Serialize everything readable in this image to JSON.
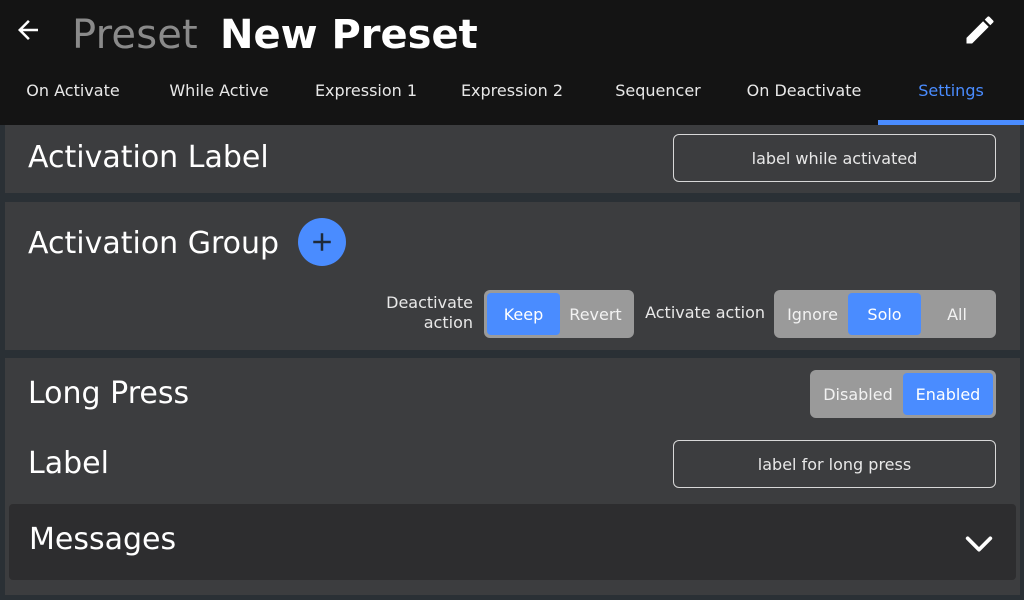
{
  "header": {
    "title_prefix": "Preset",
    "title_name": "New Preset"
  },
  "tabs": [
    {
      "label": "On Activate",
      "active": false
    },
    {
      "label": "While Active",
      "active": false
    },
    {
      "label": "Expression 1",
      "active": false
    },
    {
      "label": "Expression 2",
      "active": false
    },
    {
      "label": "Sequencer",
      "active": false
    },
    {
      "label": "On Deactivate",
      "active": false
    },
    {
      "label": "Settings",
      "active": true
    }
  ],
  "activation_label": {
    "title": "Activation Label",
    "placeholder": "label while activated"
  },
  "activation_group": {
    "title": "Activation Group",
    "deactivate_action": {
      "label_line1": "Deactivate",
      "label_line2": "action",
      "options": [
        "Keep",
        "Revert"
      ],
      "selected": "Keep"
    },
    "activate_action": {
      "label": "Activate action",
      "options": [
        "Ignore",
        "Solo",
        "All"
      ],
      "selected": "Solo"
    }
  },
  "long_press": {
    "title": "Long Press",
    "options": [
      "Disabled",
      "Enabled"
    ],
    "selected": "Enabled",
    "label_title": "Label",
    "label_placeholder": "label for long press"
  },
  "messages": {
    "title": "Messages"
  },
  "colors": {
    "accent": "#4a8cff",
    "header_bg": "#141414",
    "panel_bg": "#3c3d3f",
    "page_bg": "#2a3035"
  },
  "icons": {
    "back": "arrow-left-icon",
    "edit": "pencil-icon",
    "add": "plus-icon",
    "expand": "chevron-down-icon"
  }
}
